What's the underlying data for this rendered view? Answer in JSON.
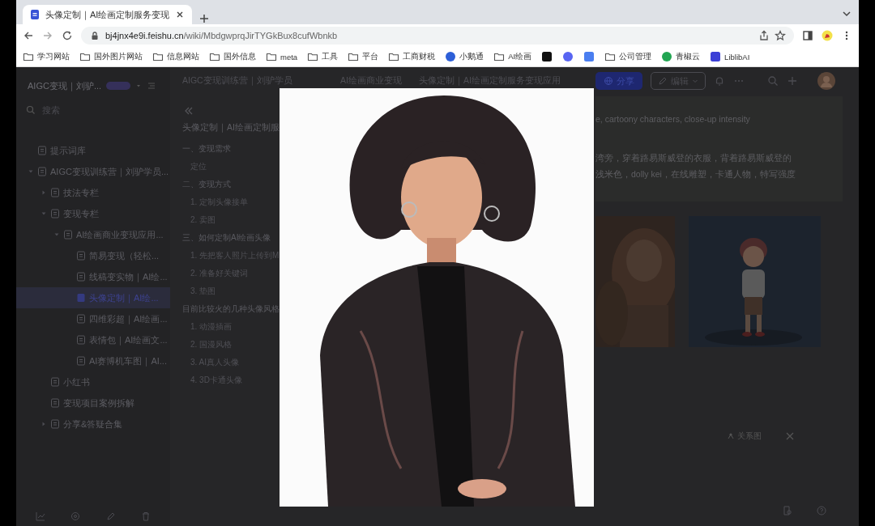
{
  "browser": {
    "tab": {
      "title": "头像定制｜AI绘画定制服务变现"
    },
    "url": {
      "host": "bj4jnx4e9i.feishu.cn",
      "path": "/wiki/MbdgwprqJirTYGkBux8cufWbnkb"
    },
    "bookmarks": [
      {
        "kind": "folder",
        "label": "学习网站"
      },
      {
        "kind": "folder",
        "label": "国外图片网站"
      },
      {
        "kind": "folder",
        "label": "信息网站"
      },
      {
        "kind": "folder",
        "label": "国外信息"
      },
      {
        "kind": "folder",
        "label": "meta"
      },
      {
        "kind": "folder",
        "label": "工具"
      },
      {
        "kind": "folder",
        "label": "平台"
      },
      {
        "kind": "folder",
        "label": "工商财税"
      },
      {
        "kind": "round",
        "color": "#2d5fd8",
        "label": "小鹅通"
      },
      {
        "kind": "folder",
        "label": "AI绘画"
      },
      {
        "kind": "square",
        "color": "#111111"
      },
      {
        "kind": "round",
        "color": "#5865f2"
      },
      {
        "kind": "square",
        "color": "#4a7ef0"
      },
      {
        "kind": "folder",
        "label": "公司管理"
      },
      {
        "kind": "round",
        "color": "#22a552",
        "label": "青椒云"
      },
      {
        "kind": "square",
        "color": "#3b3fd6",
        "label": "LiblibAI"
      }
    ]
  },
  "sidebar": {
    "title": "AIGC变现｜刘驴...",
    "search": {
      "placeholder": "搜索"
    },
    "tree": [
      {
        "label": "提示词库",
        "selected": false
      },
      {
        "label": "AIGC变现训练营｜刘驴学员...",
        "selected": false,
        "expanded": true,
        "children": [
          {
            "label": "技法专栏",
            "selected": false,
            "expanded": false
          },
          {
            "label": "变现专栏",
            "selected": false,
            "expanded": true,
            "children": [
              {
                "label": "AI绘画商业变现应用...",
                "selected": false,
                "expanded": true,
                "children": [
                  {
                    "label": "简易变现（轻松...",
                    "selected": false
                  },
                  {
                    "label": "线稿变实物｜AI绘...",
                    "selected": false
                  },
                  {
                    "label": "头像定制｜AI绘...",
                    "selected": true
                  },
                  {
                    "label": "四维彩超｜AI绘画...",
                    "selected": false
                  },
                  {
                    "label": "表情包｜AI绘画文...",
                    "selected": false
                  },
                  {
                    "label": "AI赛博机车图｜AI...",
                    "selected": false
                  }
                ]
              }
            ]
          },
          {
            "label": "小红书",
            "selected": false
          },
          {
            "label": "变现项目案例拆解",
            "selected": false
          },
          {
            "label": "分享&答疑合集",
            "selected": false,
            "expanded": false
          }
        ]
      }
    ]
  },
  "header": {
    "breadcrumbs": [
      "AIGC变现训练营｜刘驴学员",
      "AI绘画商业变现",
      "头像定制｜AI绘画定制服务变现应用"
    ],
    "share_button": "分享",
    "edit_button": "编辑"
  },
  "outline": {
    "title": "头像定制｜AI绘画定制服",
    "items": [
      {
        "kind": "heading",
        "text": "一、变现需求"
      },
      {
        "kind": "item",
        "text": "定位"
      },
      {
        "kind": "heading",
        "text": "二、变现方式"
      },
      {
        "kind": "item",
        "text": "1. 定制头像接单"
      },
      {
        "kind": "item",
        "text": "2. 卖图"
      },
      {
        "kind": "heading",
        "text": "三、如何定制AI绘画头像"
      },
      {
        "kind": "item",
        "text": "1. 先把客人照片上传到M"
      },
      {
        "kind": "item",
        "text": "2. 准备好关键词"
      },
      {
        "kind": "item",
        "text": "3. 垫图"
      },
      {
        "kind": "heading",
        "text": "目前比较火的几种头像风格"
      },
      {
        "kind": "item",
        "text": "1. 动漫插画"
      },
      {
        "kind": "item",
        "text": "2. 国漫风格"
      },
      {
        "kind": "item",
        "text": "3. AI真人头像"
      },
      {
        "kind": "item",
        "text": "4. 3D卡通头像"
      }
    ]
  },
  "document": {
    "lines": [
      "e, cartoony characters, close-up intensity",
      "湾旁，穿着路易斯威登的衣服，背着路易斯威登的",
      "浅米色，dolly kei，在线雕塑，卡通人物，特写强度"
    ],
    "relation_button": "关系图"
  }
}
